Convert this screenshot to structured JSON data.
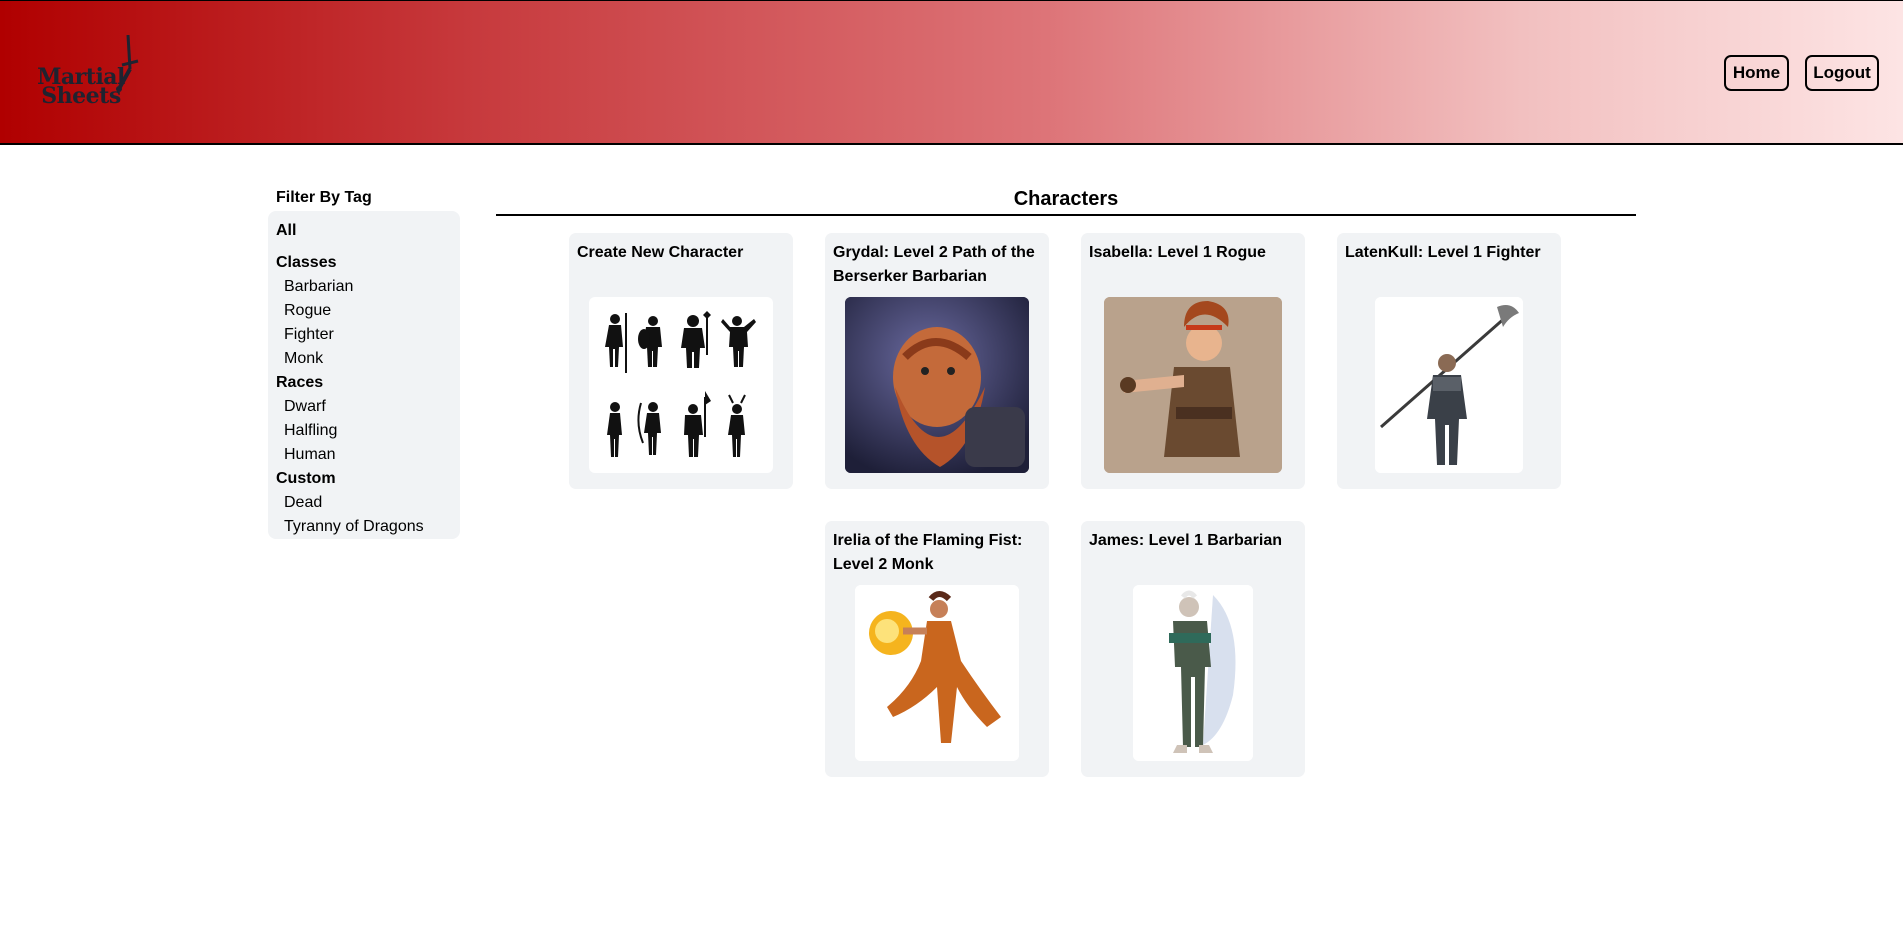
{
  "header": {
    "logo_text_line1": "Martial",
    "logo_text_line2": "Sheets",
    "home_label": "Home",
    "logout_label": "Logout"
  },
  "sidebar": {
    "title": "Filter By Tag",
    "all_label": "All",
    "groups": [
      {
        "label": "Classes",
        "items": [
          "Barbarian",
          "Rogue",
          "Fighter",
          "Monk"
        ]
      },
      {
        "label": "Races",
        "items": [
          "Dwarf",
          "Halfling",
          "Human"
        ]
      },
      {
        "label": "Custom",
        "items": [
          "Dead",
          "Tyranny of Dragons"
        ]
      }
    ]
  },
  "main": {
    "title": "Characters",
    "cards": [
      {
        "title": "Create New Character",
        "image": "silhouettes-icon"
      },
      {
        "title": "Grydal: Level 2 Path of the Berserker Barbarian",
        "image": "dwarf-portrait"
      },
      {
        "title": "Isabella: Level 1 Rogue",
        "image": "halfling-rogue-portrait"
      },
      {
        "title": "LatenKull: Level 1 Fighter",
        "image": "human-fighter-portrait"
      },
      {
        "title": "Irelia of the Flaming Fist: Level 2 Monk",
        "image": "fire-monk-portrait"
      },
      {
        "title": "James: Level 1 Barbarian",
        "image": "barbarian-portrait"
      }
    ]
  },
  "colors": {
    "header_gradient_start": "#b00000",
    "header_gradient_end": "#fde4e4",
    "panel_background": "#f1f3f5"
  }
}
